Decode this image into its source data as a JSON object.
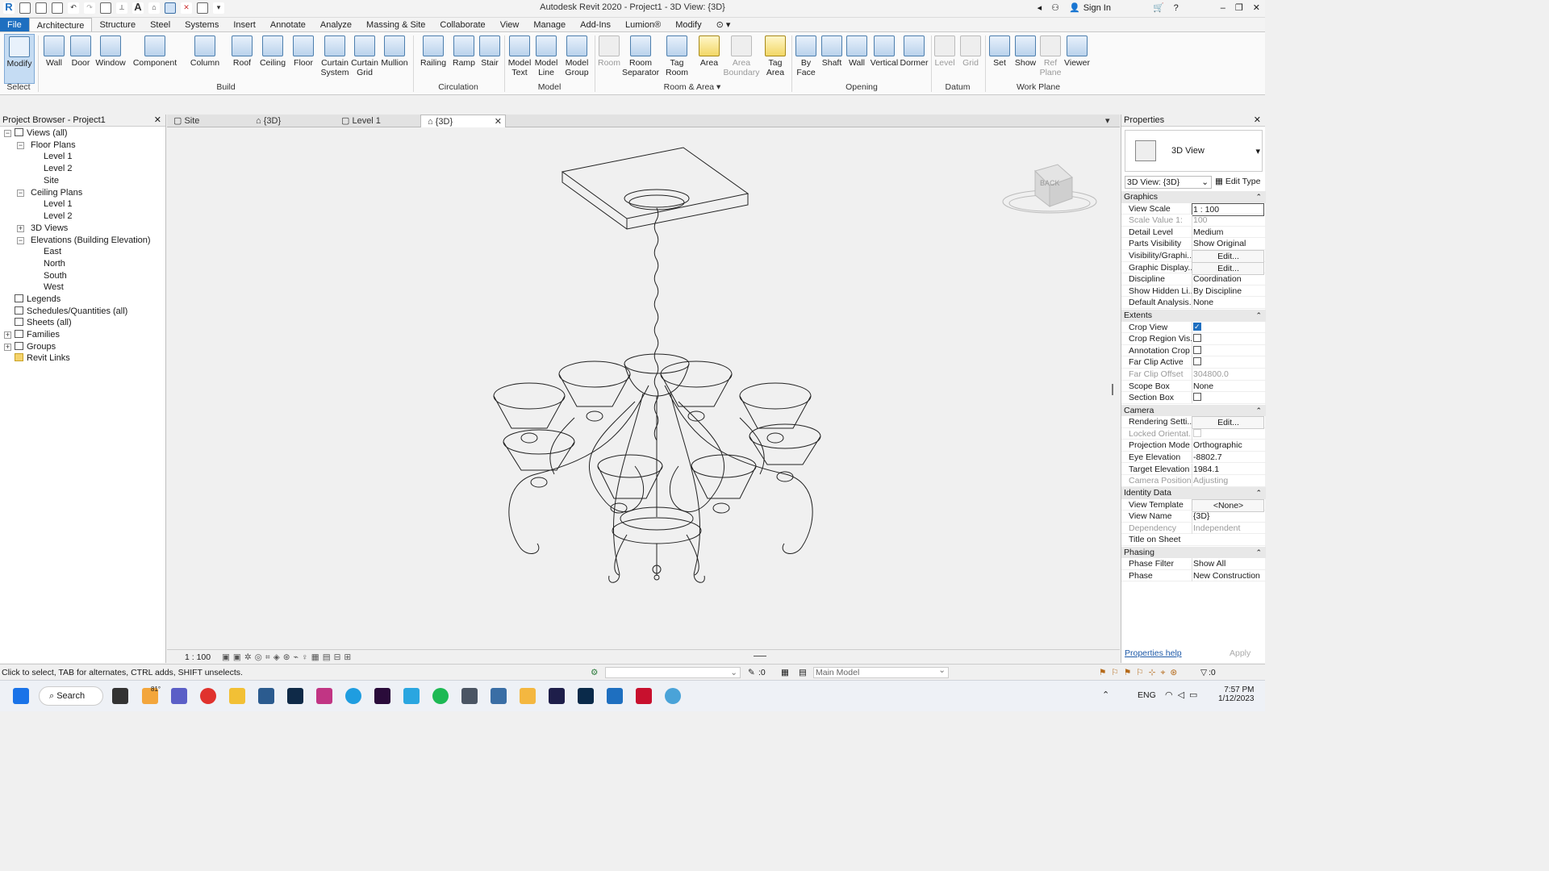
{
  "app_title": "Autodesk Revit 2020 - Project1 - 3D View: {3D}",
  "title_right": {
    "signin": "Sign In"
  },
  "ribbon_tabs": [
    "File",
    "Architecture",
    "Structure",
    "Steel",
    "Systems",
    "Insert",
    "Annotate",
    "Analyze",
    "Massing & Site",
    "Collaborate",
    "View",
    "Manage",
    "Add-Ins",
    "Lumion®",
    "Modify"
  ],
  "ribbon": {
    "modify": "Modify",
    "select": "Select",
    "build": [
      "Wall",
      "Door",
      "Window",
      "Component",
      "Column",
      "Roof",
      "Ceiling",
      "Floor",
      "Curtain System",
      "Curtain Grid",
      "Mullion"
    ],
    "build_label": "Build",
    "circulation": [
      "Railing",
      "Ramp",
      "Stair"
    ],
    "circulation_label": "Circulation",
    "model": [
      "Model Text",
      "Model Line",
      "Model Group"
    ],
    "model_label": "Model",
    "room": [
      "Room",
      "Room Separator",
      "Tag Room",
      "Area",
      "Area Boundary",
      "Tag Area"
    ],
    "room_label": "Room & Area",
    "opening": [
      "By Face",
      "Shaft",
      "Wall",
      "Vertical",
      "Dormer"
    ],
    "opening_label": "Opening",
    "datum": [
      "Level",
      "Grid"
    ],
    "datum_label": "Datum",
    "workplane": [
      "Set",
      "Show",
      "Ref Plane",
      "Viewer"
    ],
    "workplane_label": "Work Plane"
  },
  "browser": {
    "title": "Project Browser - Project1",
    "items": [
      "Views (all)",
      "Floor Plans",
      "Level 1",
      "Level 2",
      "Site",
      "Ceiling Plans",
      "Level 1",
      "Level 2",
      "3D Views",
      "Elevations (Building Elevation)",
      "East",
      "North",
      "South",
      "West",
      "Legends",
      "Schedules/Quantities (all)",
      "Sheets (all)",
      "Families",
      "Groups",
      "Revit Links"
    ]
  },
  "doc_tabs": [
    "Site",
    "{3D}",
    "Level 1",
    "{3D}"
  ],
  "viewcube_label": "BACK",
  "view_scale": "1 : 100",
  "properties": {
    "title": "Properties",
    "type_name": "3D View",
    "selector": "3D View: {3D}",
    "edit_type": "Edit Type",
    "sections": {
      "graphics": "Graphics",
      "extents": "Extents",
      "camera": "Camera",
      "identity": "Identity Data",
      "phasing": "Phasing"
    },
    "rows": {
      "view_scale": [
        "View Scale",
        "1 : 100"
      ],
      "scale_value": [
        "Scale Value    1:",
        "100"
      ],
      "detail_level": [
        "Detail Level",
        "Medium"
      ],
      "parts_visibility": [
        "Parts Visibility",
        "Show Original"
      ],
      "visibility": [
        "Visibility/Graphi...",
        "Edit..."
      ],
      "graphic_display": [
        "Graphic Display...",
        "Edit..."
      ],
      "discipline": [
        "Discipline",
        "Coordination"
      ],
      "show_hidden": [
        "Show Hidden Li...",
        "By Discipline"
      ],
      "default_analysis": [
        "Default Analysis...",
        "None"
      ],
      "crop_view": [
        "Crop View",
        ""
      ],
      "crop_region": [
        "Crop Region Vis...",
        ""
      ],
      "annotation_crop": [
        "Annotation Crop",
        ""
      ],
      "far_clip_active": [
        "Far Clip Active",
        ""
      ],
      "far_clip_offset": [
        "Far Clip Offset",
        "304800.0"
      ],
      "scope_box": [
        "Scope Box",
        "None"
      ],
      "section_box": [
        "Section Box",
        ""
      ],
      "rendering": [
        "Rendering Setti...",
        "Edit..."
      ],
      "locked_orient": [
        "Locked Orientat...",
        ""
      ],
      "projection": [
        "Projection Mode",
        "Orthographic"
      ],
      "eye_elev": [
        "Eye Elevation",
        "-8802.7"
      ],
      "target_elev": [
        "Target Elevation",
        "1984.1"
      ],
      "camera_pos": [
        "Camera Position",
        "Adjusting"
      ],
      "view_template": [
        "View Template",
        "<None>"
      ],
      "view_name": [
        "View Name",
        "{3D}"
      ],
      "dependency": [
        "Dependency",
        "Independent"
      ],
      "title_on_sheet": [
        "Title on Sheet",
        ""
      ],
      "phase_filter": [
        "Phase Filter",
        "Show All"
      ],
      "phase": [
        "Phase",
        "New Construction"
      ]
    },
    "help": "Properties help",
    "apply": "Apply"
  },
  "status": {
    "hint": "Click to select, TAB for alternates, CTRL adds, SHIFT unselects.",
    "zero": ":0",
    "main_model": "Main Model",
    "filter_count": ":0"
  },
  "taskbar": {
    "search": "Search",
    "weather": "81°",
    "lang": "ENG",
    "time": "7:57 PM",
    "date": "1/12/2023"
  }
}
